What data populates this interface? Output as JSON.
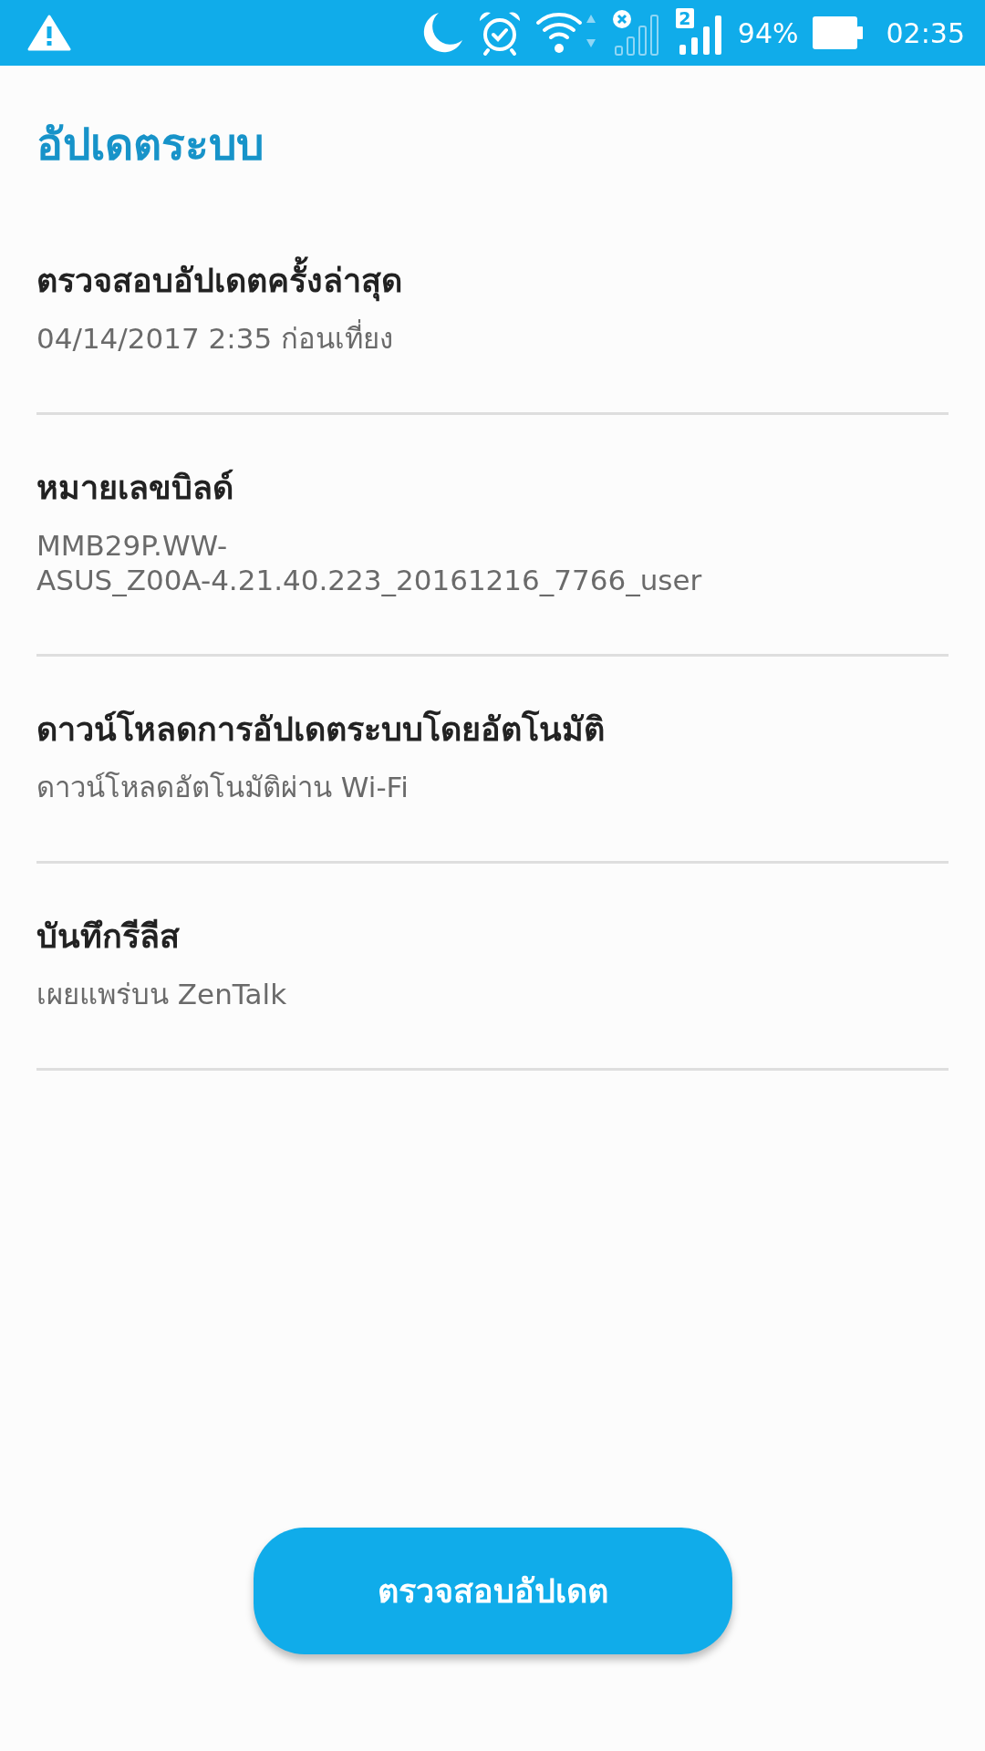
{
  "status_bar": {
    "sim_badge": "2",
    "battery": "94%",
    "time": "02:35"
  },
  "title": "อัปเดตระบบ",
  "items": [
    {
      "title": "ตรวจสอบอัปเดตครั้งล่าสุด",
      "summary": "04/14/2017 2:35 ก่อนเที่ยง"
    },
    {
      "title": "หมายเลขบิลด์",
      "summary": "MMB29P.WW-\nASUS_Z00A-4.21.40.223_20161216_7766_user"
    },
    {
      "title": "ดาวน์โหลดการอัปเดตระบบโดยอัตโนมัติ",
      "summary": "ดาวน์โหลดอัตโนมัติผ่าน Wi-Fi"
    },
    {
      "title": "บันทึกรีลีส",
      "summary": "เผยแพร่บน ZenTalk"
    }
  ],
  "button": "ตรวจสอบอัปเดต"
}
